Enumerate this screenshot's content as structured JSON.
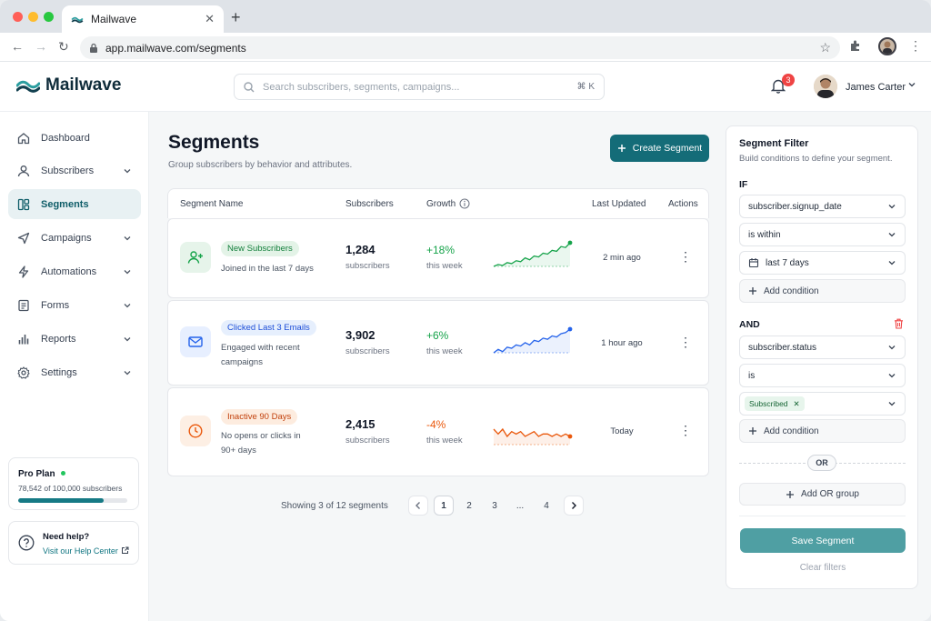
{
  "browser": {
    "tab_title": "Mailwave",
    "url": "app.mailwave.com/segments"
  },
  "app": {
    "name": "Mailwave",
    "search_placeholder": "Search subscribers, segments, campaigns...",
    "search_shortcut": "⌘ K",
    "notification_count": "3",
    "user_name": "James Carter"
  },
  "sidebar": {
    "items": [
      {
        "label": "Dashboard",
        "icon": "home-icon"
      },
      {
        "label": "Subscribers",
        "icon": "user-icon"
      },
      {
        "label": "Segments",
        "icon": "segments-icon"
      },
      {
        "label": "Campaigns",
        "icon": "send-icon"
      },
      {
        "label": "Automations",
        "icon": "bolt-icon"
      },
      {
        "label": "Forms",
        "icon": "form-icon"
      },
      {
        "label": "Reports",
        "icon": "bar-chart-icon"
      },
      {
        "label": "Settings",
        "icon": "gear-icon"
      }
    ],
    "plan": {
      "title": "Pro Plan",
      "usage": "78,542 of 100,000 subscribers",
      "fraction": 0.785
    },
    "help": {
      "title": "Need help?",
      "link": "Visit our Help Center"
    }
  },
  "main": {
    "title": "Segments",
    "subtitle": "Group subscribers by behavior and attributes.",
    "create_label": "Create Segment",
    "columns": {
      "name": "Segment Name",
      "subscribers": "Subscribers",
      "growth": "Growth",
      "updated": "Last Updated",
      "actions": "Actions"
    },
    "rows": [
      {
        "name": "New Subscribers",
        "desc": "Joined in the last 7 days",
        "count": "1,284",
        "count_label": "subscribers",
        "growth": "+18%",
        "growth_label": "this week",
        "updated": "2 min ago",
        "icon": "user-plus-icon",
        "spark": [
          3,
          5,
          4,
          7,
          6,
          9,
          8,
          12,
          10,
          14,
          13,
          17,
          16,
          20,
          19,
          24,
          23,
          28
        ]
      },
      {
        "name": "Clicked Last 3 Emails",
        "desc": "Engaged with recent campaigns",
        "count": "3,902",
        "count_label": "subscribers",
        "growth": "+6%",
        "growth_label": "this week",
        "updated": "1 hour ago",
        "icon": "mail-icon",
        "spark": [
          5,
          8,
          6,
          10,
          9,
          12,
          11,
          14,
          12,
          16,
          15,
          18,
          17,
          20,
          19,
          22,
          23,
          26
        ]
      },
      {
        "name": "Inactive 90 Days",
        "desc": "No opens or clicks in 90+ days",
        "count": "2,415",
        "count_label": "subscribers",
        "growth": "-4%",
        "growth_label": "this week",
        "updated": "Today",
        "icon": "clock-icon",
        "spark": [
          14,
          12,
          14,
          11,
          13,
          12,
          13,
          11,
          12,
          13,
          11,
          12,
          12,
          11,
          12,
          11,
          12,
          11
        ]
      }
    ],
    "pagination": {
      "summary": "Showing 3 of 12 segments",
      "pages": [
        "1",
        "2",
        "3",
        "...",
        "4"
      ]
    }
  },
  "filter": {
    "title": "Segment Filter",
    "subtitle": "Build conditions to define your segment.",
    "if_label": "IF",
    "and_label": "AND",
    "or_label": "OR",
    "group1": [
      "subscriber.signup_date",
      "is within",
      "last 7 days"
    ],
    "group2": [
      "subscriber.status",
      "is"
    ],
    "chip": "Subscribed",
    "add_condition": "Add condition",
    "add_or_group": "Add OR group",
    "save_label": "Save Segment",
    "clear_label": "Clear filters"
  },
  "colors": {
    "accent": "#146c78",
    "green": "#16a34a",
    "blue": "#2563eb",
    "orange": "#ea580c"
  }
}
